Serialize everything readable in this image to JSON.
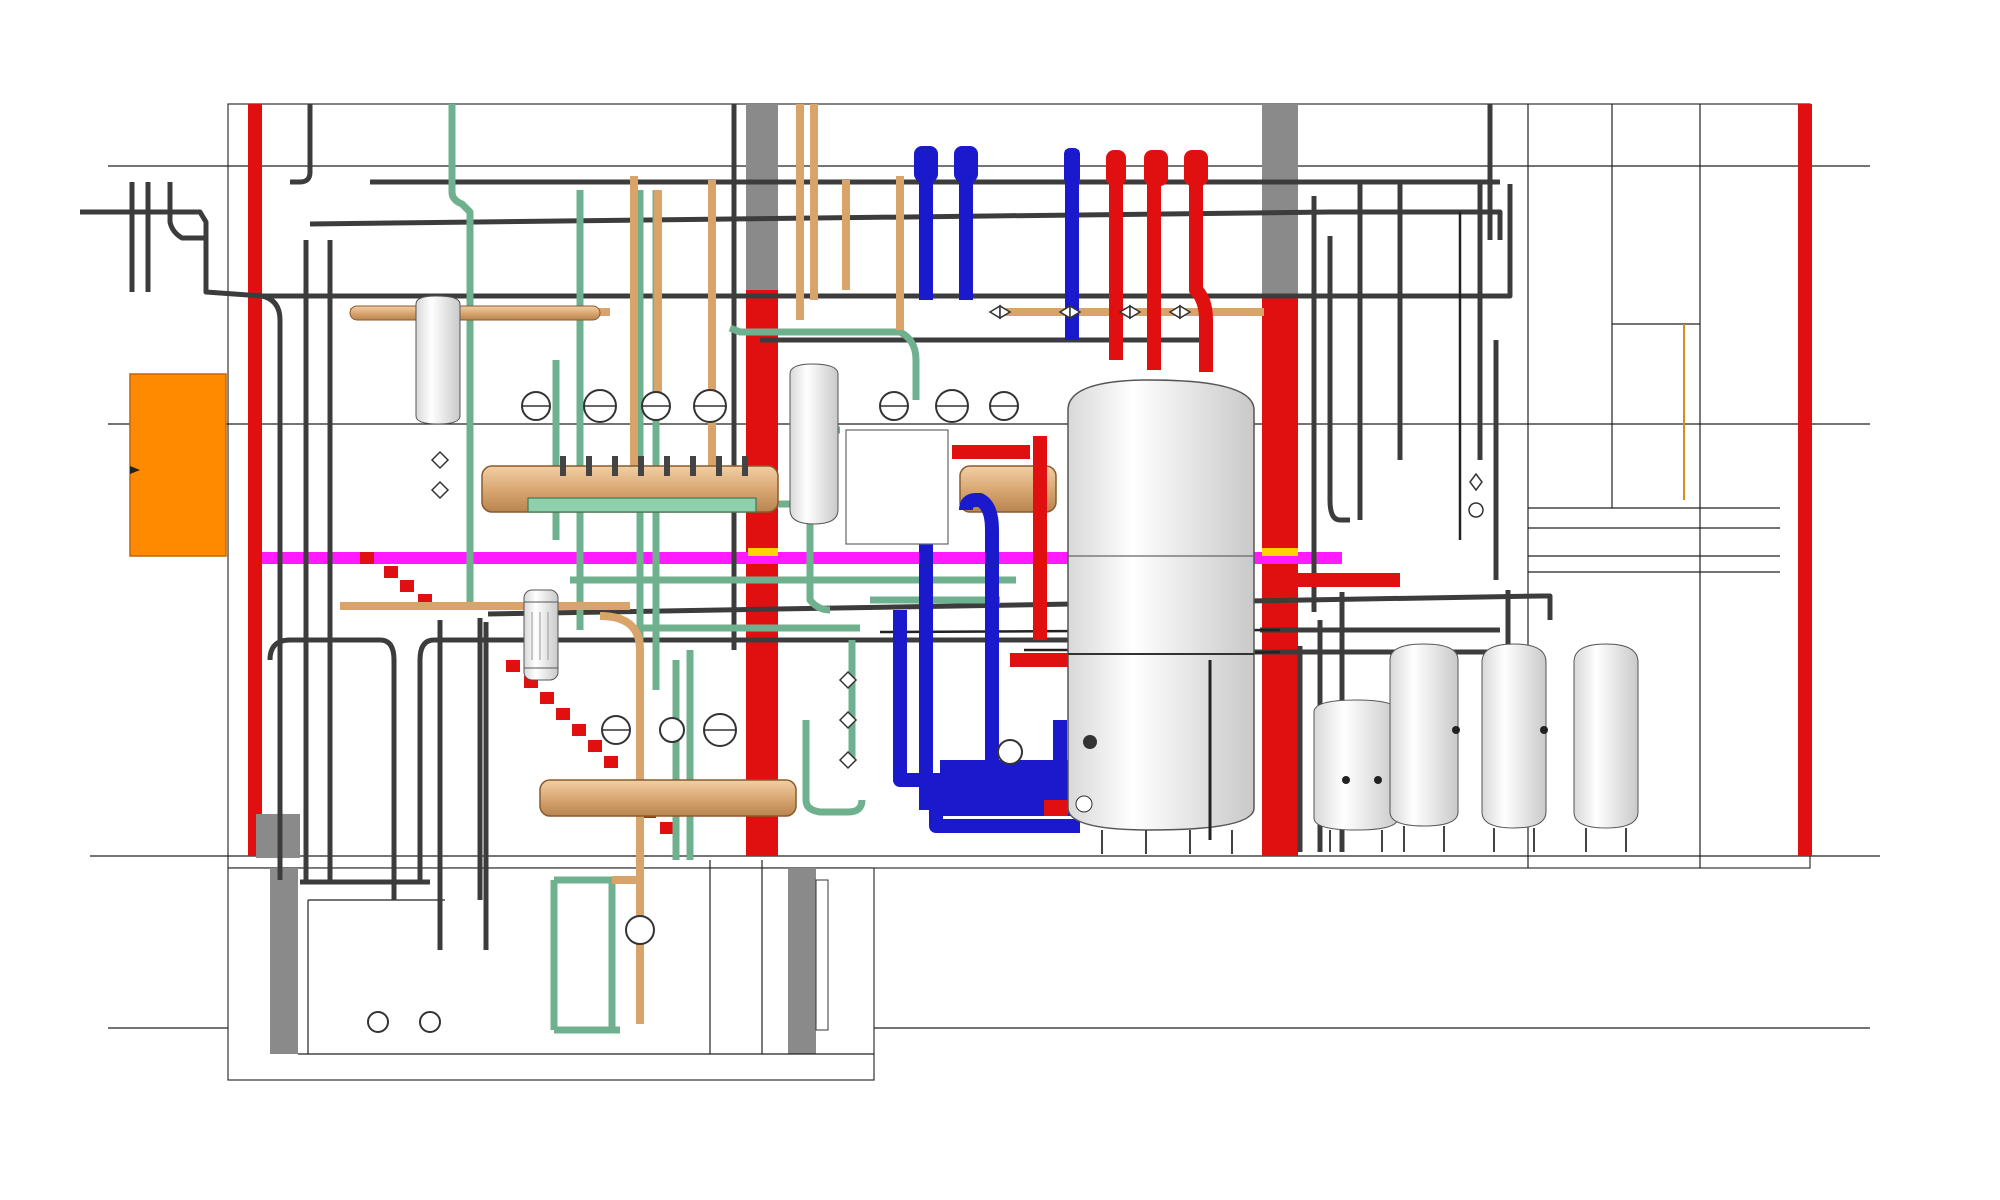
{
  "colors": {
    "background": "#ffffff",
    "fire_wall": "#e01010",
    "concrete_column": "#8a8a8a",
    "orange_panel": "#ff8a00",
    "magenta_beam": "#ff1aff",
    "supply_red": "#e01010",
    "return_blue": "#1a1acc",
    "copper_pipe": "#d9a46a",
    "green_pipe": "#6fb08e",
    "steel_pipe": "#3c3c3c",
    "tank_white": "#f4f4f4"
  },
  "diagram": {
    "text_labels": [],
    "elements": [
      "building-section-outline",
      "fire-rated-walls",
      "concrete-columns",
      "electrical-panel",
      "buffer-storage-tank",
      "expansion-vessels",
      "circulation-pumps",
      "distribution-manifolds",
      "dirt-separator",
      "pipe-network",
      "basement-pit"
    ]
  }
}
